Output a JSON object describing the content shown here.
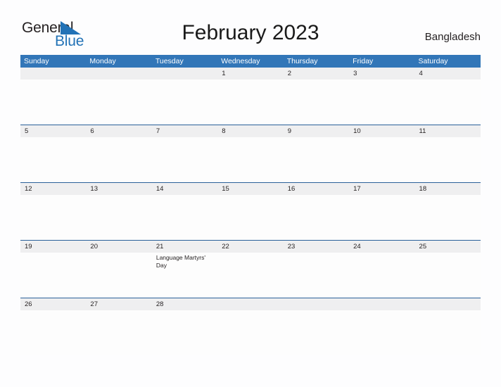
{
  "logo": {
    "word_top": "General",
    "word_bottom": "Blue",
    "flag_color": "#2272b6",
    "text_color": "#231f20"
  },
  "header": {
    "title": "February 2023",
    "country": "Bangladesh"
  },
  "colors": {
    "header_blue": "#3276b8",
    "row_border_blue": "#2a6099",
    "date_band_gray": "#efeff0",
    "page_background": "#fdfdfe"
  },
  "calendar": {
    "weekdays": [
      "Sunday",
      "Monday",
      "Tuesday",
      "Wednesday",
      "Thursday",
      "Friday",
      "Saturday"
    ],
    "weeks": [
      {
        "days": [
          {
            "date": "",
            "events": []
          },
          {
            "date": "",
            "events": []
          },
          {
            "date": "",
            "events": []
          },
          {
            "date": "1",
            "events": []
          },
          {
            "date": "2",
            "events": []
          },
          {
            "date": "3",
            "events": []
          },
          {
            "date": "4",
            "events": []
          }
        ]
      },
      {
        "days": [
          {
            "date": "5",
            "events": []
          },
          {
            "date": "6",
            "events": []
          },
          {
            "date": "7",
            "events": []
          },
          {
            "date": "8",
            "events": []
          },
          {
            "date": "9",
            "events": []
          },
          {
            "date": "10",
            "events": []
          },
          {
            "date": "11",
            "events": []
          }
        ]
      },
      {
        "days": [
          {
            "date": "12",
            "events": []
          },
          {
            "date": "13",
            "events": []
          },
          {
            "date": "14",
            "events": []
          },
          {
            "date": "15",
            "events": []
          },
          {
            "date": "16",
            "events": []
          },
          {
            "date": "17",
            "events": []
          },
          {
            "date": "18",
            "events": []
          }
        ]
      },
      {
        "days": [
          {
            "date": "19",
            "events": []
          },
          {
            "date": "20",
            "events": []
          },
          {
            "date": "21",
            "events": [
              "Language Martyrs' Day"
            ]
          },
          {
            "date": "22",
            "events": []
          },
          {
            "date": "23",
            "events": []
          },
          {
            "date": "24",
            "events": []
          },
          {
            "date": "25",
            "events": []
          }
        ]
      },
      {
        "days": [
          {
            "date": "26",
            "events": []
          },
          {
            "date": "27",
            "events": []
          },
          {
            "date": "28",
            "events": []
          },
          {
            "date": "",
            "events": []
          },
          {
            "date": "",
            "events": []
          },
          {
            "date": "",
            "events": []
          },
          {
            "date": "",
            "events": []
          }
        ]
      }
    ]
  }
}
